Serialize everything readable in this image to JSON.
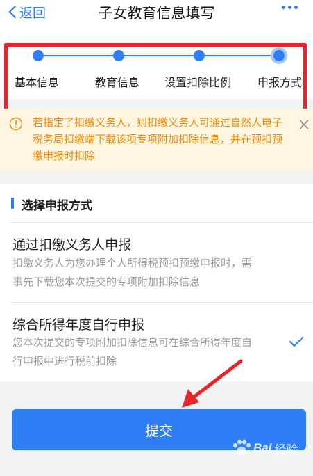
{
  "header": {
    "back_label": "返回",
    "title": "子女教育信息填写"
  },
  "stepper": {
    "steps": [
      {
        "label": "基本信息"
      },
      {
        "label": "教育信息"
      },
      {
        "label": "设置扣除比例"
      },
      {
        "label": "申报方式"
      }
    ],
    "current_step": 4
  },
  "notice": {
    "text": "若指定了扣缴义务人，则扣缴义务人可通过自然人电子税务局扣缴端下载该项专项附加扣除信息，并在预扣预缴申报时扣除"
  },
  "section": {
    "title": "选择申报方式",
    "options": [
      {
        "title": "通过扣缴义务人申报",
        "desc": "扣缴义务人为您办理个人所得税预扣预缴申报时，需事先下载您本次提交的专项附加扣除信息",
        "selected": false
      },
      {
        "title": "综合所得年度自行申报",
        "desc": "您本次提交的专项附加扣除信息可在综合所得年度自行申报中进行税前扣除",
        "selected": true
      }
    ]
  },
  "submit_label": "提交",
  "watermark": "经验",
  "colors": {
    "accent": "#2f7ef5",
    "notice_bg": "#fff6e2",
    "notice_text": "#f08a0a",
    "highlight": "#e8252b"
  }
}
